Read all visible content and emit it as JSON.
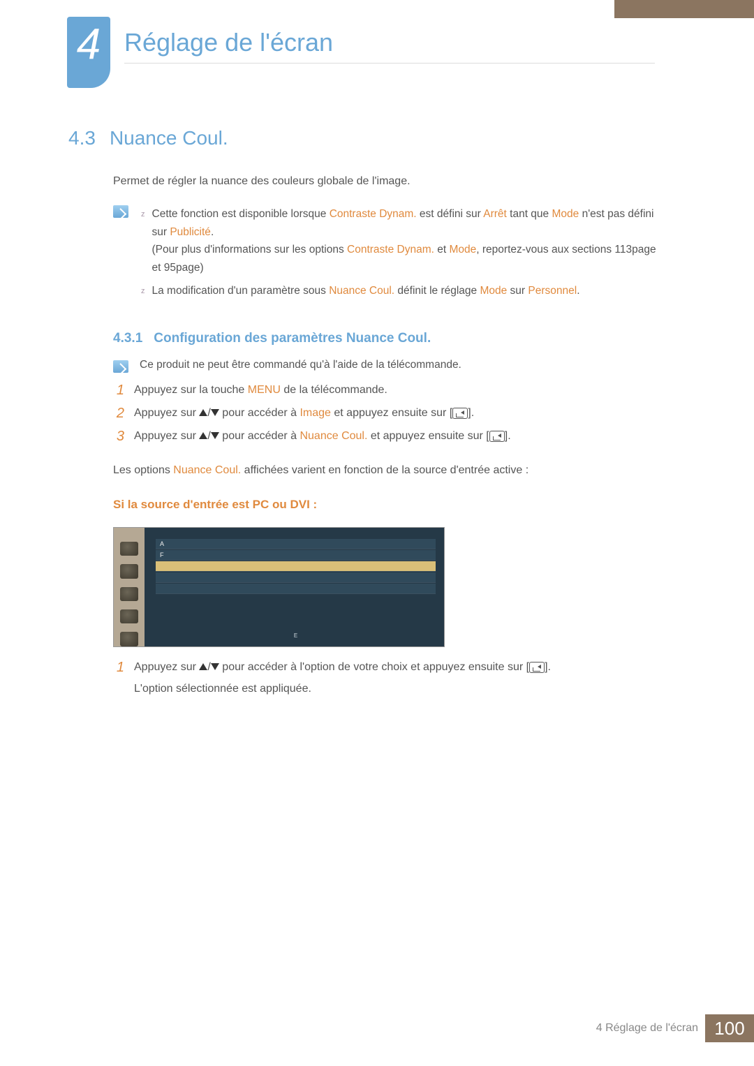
{
  "chapter": {
    "number": "4",
    "title": "Réglage de l'écran"
  },
  "section": {
    "number": "4.3",
    "title": "Nuance Coul."
  },
  "intro": "Permet de régler la nuance des couleurs globale de l'image.",
  "notes": {
    "n1a": "Cette fonction est disponible lorsque ",
    "n1b": "Contraste Dynam.",
    "n1c": " est défini sur ",
    "n1d": "Arrêt",
    "n1e": " tant que ",
    "n1f": "Mode",
    "n1g": " n'est pas défini sur ",
    "n1h": "Publicité",
    "n1i": ".",
    "n1_ext_a": "(Pour plus d'informations sur les options ",
    "n1_ext_b": "Contraste Dynam.",
    "n1_ext_c": " et ",
    "n1_ext_d": "Mode",
    "n1_ext_e": ", reportez-vous aux sections 113page et 95page)",
    "n2a": "La modification d'un paramètre sous ",
    "n2b": "Nuance Coul.",
    "n2c": " définit le réglage ",
    "n2d": "Mode",
    "n2e": " sur ",
    "n2f": "Personnel",
    "n2g": "."
  },
  "subsection": {
    "number": "4.3.1",
    "title": "Configuration des paramètres Nuance Coul."
  },
  "remote_note": "Ce produit ne peut être commandé qu'à l'aide de la télécommande.",
  "steps": {
    "s1a": "Appuyez sur la touche ",
    "s1b": "MENU",
    "s1c": " de la télécommande.",
    "s2a": "Appuyez sur ",
    "s2b": " pour accéder à ",
    "s2c": "Image",
    "s2d": " et appuyez ensuite sur [",
    "s2e": "].",
    "s3a": "Appuyez sur ",
    "s3b": " pour accéder à ",
    "s3c": "Nuance Coul.",
    "s3d": " et appuyez ensuite sur [",
    "s3e": "]."
  },
  "para_a": "Les options ",
  "para_b": "Nuance Coul.",
  "para_c": " affichées varient en fonction de la source d'entrée active :",
  "subheading": "Si la source d'entrée est PC ou DVI :",
  "osd": {
    "rows": [
      "A",
      "F",
      "",
      "",
      ""
    ],
    "bottom": [
      "",
      "E",
      ""
    ]
  },
  "after": {
    "s1a": "Appuyez sur ",
    "s1b": " pour accéder à l'option de votre choix et appuyez ensuite sur [",
    "s1c": "].",
    "s1d": "L'option sélectionnée est appliquée."
  },
  "footer": {
    "label": "4 Réglage de l'écran",
    "page": "100"
  }
}
